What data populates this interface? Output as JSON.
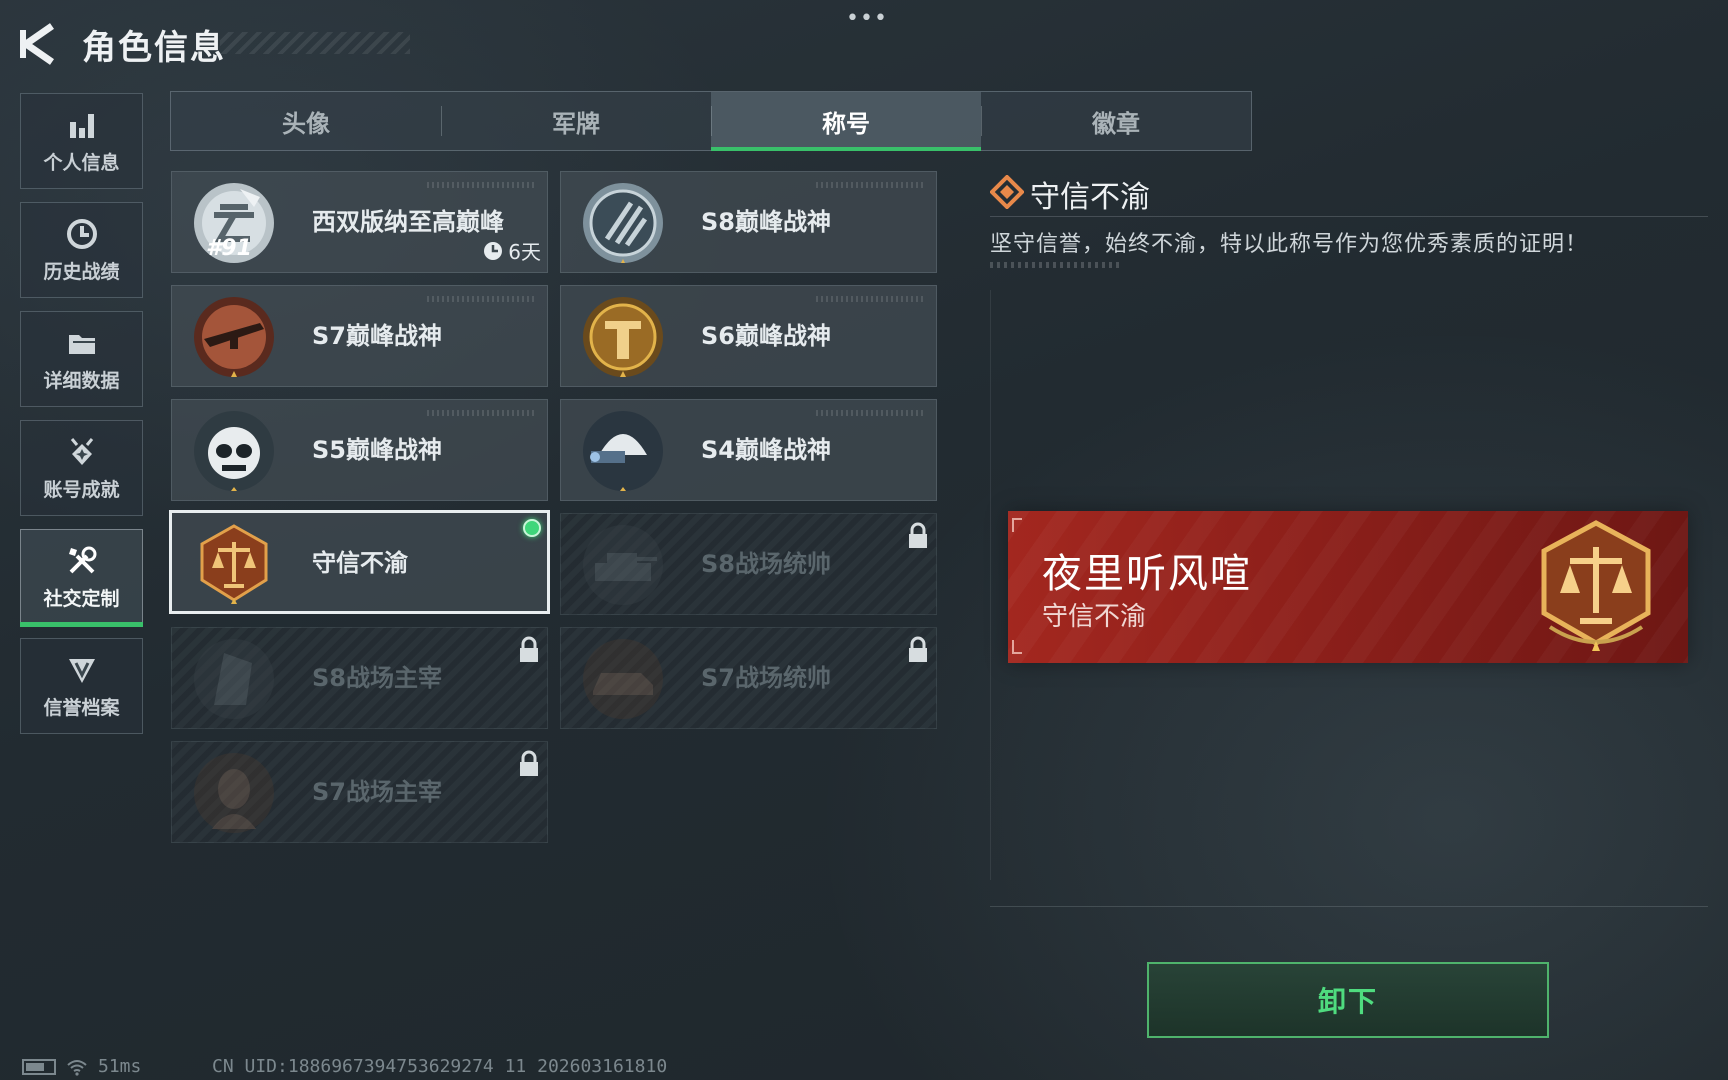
{
  "header": {
    "title": "角色信息",
    "back_icon": "back-arrow-icon",
    "more_icon": "more-dots-icon",
    "more_label": "•••"
  },
  "sidebar": {
    "items": [
      {
        "label": "个人信息",
        "icon": "bar-chart-icon"
      },
      {
        "label": "历史战绩",
        "icon": "history-clock-icon"
      },
      {
        "label": "详细数据",
        "icon": "folder-icon"
      },
      {
        "label": "账号成就",
        "icon": "achievement-icon"
      },
      {
        "label": "社交定制",
        "icon": "tools-icon",
        "active": true
      },
      {
        "label": "信誉档案",
        "icon": "credit-shield-icon"
      }
    ]
  },
  "tabs": [
    {
      "label": "头像"
    },
    {
      "label": "军牌"
    },
    {
      "label": "称号",
      "active": true
    },
    {
      "label": "徽章"
    }
  ],
  "titles": [
    {
      "name": "西双版纳至高巅峰",
      "rank": "#91",
      "timer": "6天",
      "badge": "cloud-emblem-icon",
      "state": "owned"
    },
    {
      "name": "S8巅峰战神",
      "badge": "s8-emblem-icon",
      "state": "owned"
    },
    {
      "name": "S7巅峰战神",
      "badge": "rifle-emblem-icon",
      "state": "owned"
    },
    {
      "name": "S6巅峰战神",
      "badge": "helmet-emblem-icon",
      "state": "owned"
    },
    {
      "name": "S5巅峰战神",
      "badge": "skull-emblem-icon",
      "state": "owned"
    },
    {
      "name": "S4巅峰战神",
      "badge": "nightvision-emblem-icon",
      "state": "owned"
    },
    {
      "name": "守信不渝",
      "badge": "scales-emblem-icon",
      "state": "equipped"
    },
    {
      "name": "S8战场统帅",
      "badge": "tank-emblem-icon",
      "state": "locked"
    },
    {
      "name": "S8战场主宰",
      "badge": "building-emblem-icon",
      "state": "locked"
    },
    {
      "name": "S7战场统帅",
      "badge": "vehicle-emblem-icon",
      "state": "locked"
    },
    {
      "name": "S7战场主宰",
      "badge": "soldier-emblem-icon",
      "state": "locked"
    }
  ],
  "detail": {
    "title": "守信不渝",
    "description": "坚守信誉，始终不渝，特以此称号作为您优秀素质的证明！"
  },
  "nameplate": {
    "player_name": "夜里听风喧",
    "title": "守信不渝",
    "badge": "scales-emblem-icon",
    "color": "#a3271f"
  },
  "actions": {
    "unequip_label": "卸下"
  },
  "status": {
    "ping": "51ms",
    "uid": "CN UID:1886967394753629274 11 202603161810"
  },
  "colors": {
    "accent": "#39c06a",
    "button_text": "#4fdc7f"
  }
}
